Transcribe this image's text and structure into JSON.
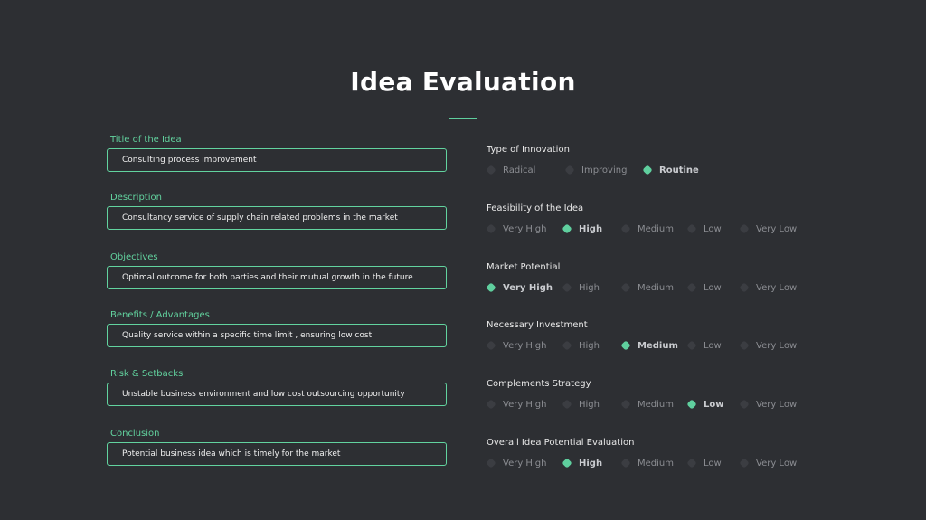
{
  "title": "Idea Evaluation",
  "fields": [
    {
      "label": "Title of the Idea",
      "value": "Consulting process improvement"
    },
    {
      "label": "Description",
      "value": "Consultancy service of supply chain related problems in the market"
    },
    {
      "label": "Objectives",
      "value": "Optimal outcome for both parties and their mutual growth in the future"
    },
    {
      "label": "Benefits / Advantages",
      "value": "Quality service within a specific time limit , ensuring low cost"
    },
    {
      "label": "Risk & Setbacks",
      "value": "Unstable business environment and low cost outsourcing opportunity"
    },
    {
      "label": "Conclusion",
      "value": "Potential business idea which is timely for the market"
    }
  ],
  "ratings": [
    {
      "label": "Type of Innovation",
      "options": [
        "Radical",
        "Improving",
        "Routine"
      ],
      "selected": "Routine"
    },
    {
      "label": "Feasibility of the Idea",
      "options": [
        "Very High",
        "High",
        "Medium",
        "Low",
        "Very Low"
      ],
      "selected": "High"
    },
    {
      "label": "Market Potential",
      "options": [
        "Very High",
        "High",
        "Medium",
        "Low",
        "Very Low"
      ],
      "selected": "Very High"
    },
    {
      "label": "Necessary Investment",
      "options": [
        "Very High",
        "High",
        "Medium",
        "Low",
        "Very Low"
      ],
      "selected": "Medium"
    },
    {
      "label": "Complements Strategy",
      "options": [
        "Very High",
        "High",
        "Medium",
        "Low",
        "Very Low"
      ],
      "selected": "Low"
    },
    {
      "label": "Overall Idea Potential Evaluation",
      "options": [
        "Very High",
        "High",
        "Medium",
        "Low",
        "Very Low"
      ],
      "selected": "High"
    }
  ],
  "colors": {
    "accent": "#5fcf9e",
    "background": "#2d2f33"
  }
}
